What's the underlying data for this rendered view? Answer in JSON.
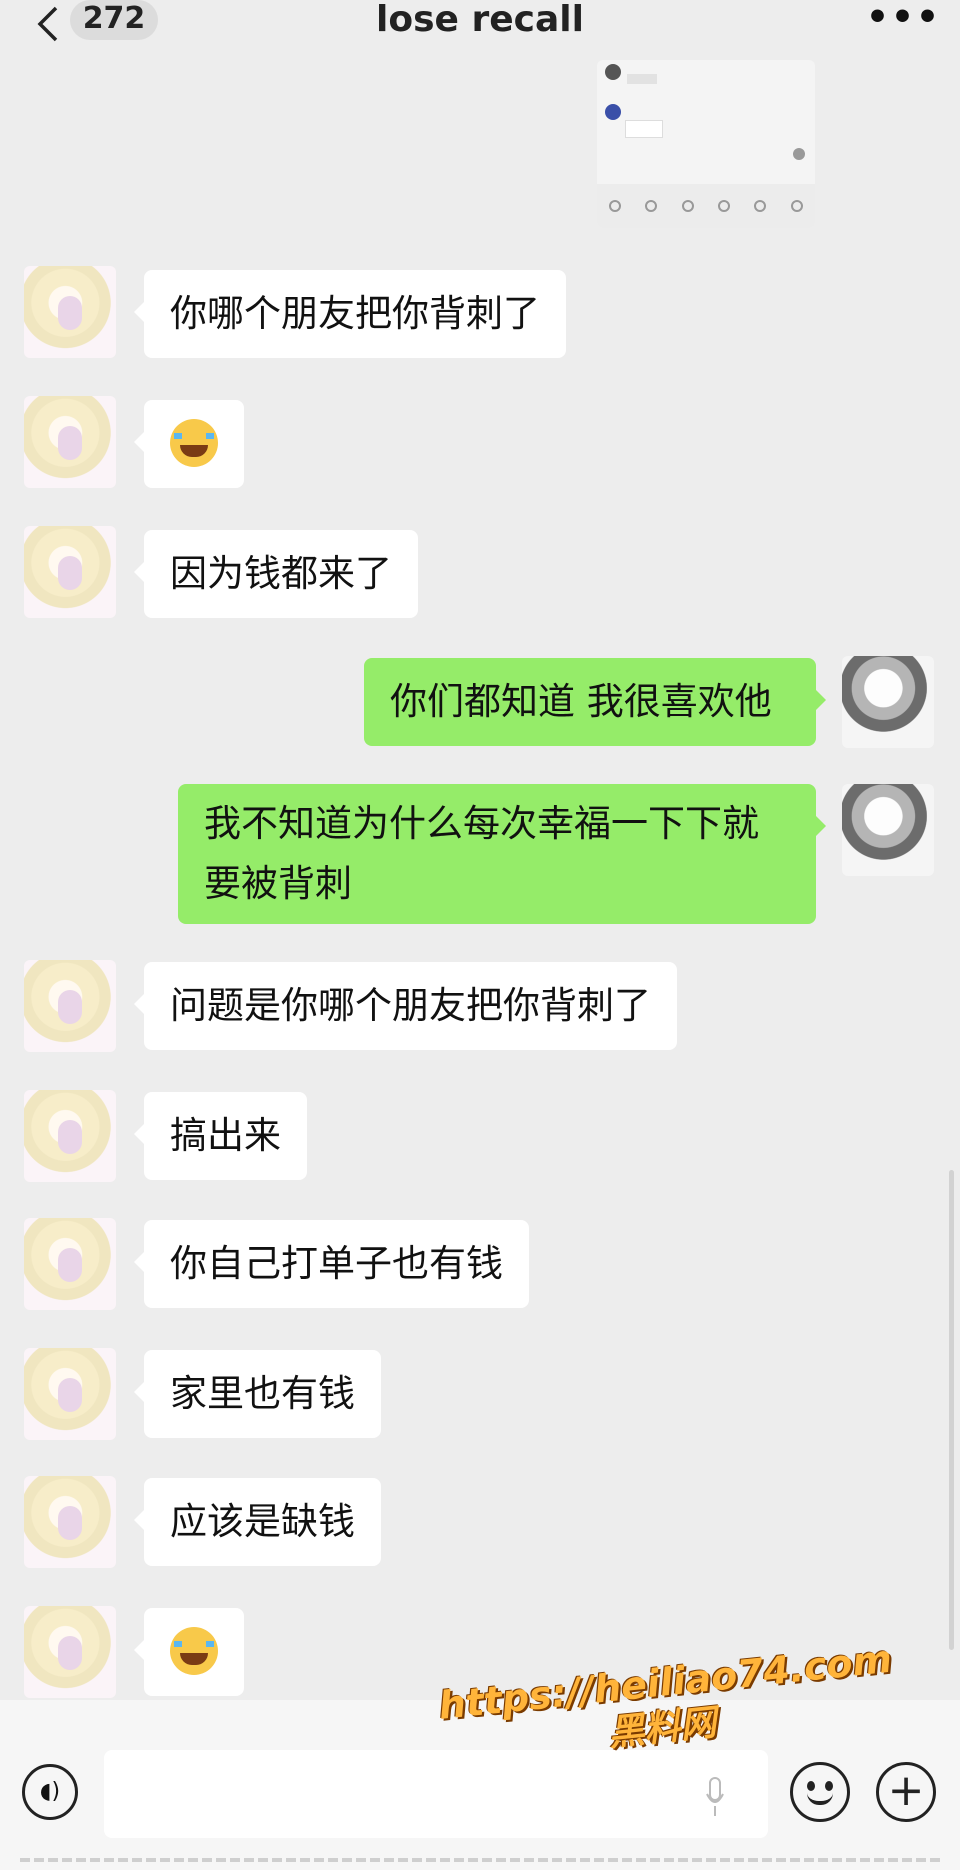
{
  "header": {
    "unread_count": "272",
    "title": "lose recall"
  },
  "messages": [
    {
      "side": "left",
      "text": "你哪个朋友把你背刺了"
    },
    {
      "side": "left",
      "emoji": "laughing-crying-emoji"
    },
    {
      "side": "left",
      "text": "因为钱都来了"
    },
    {
      "side": "right",
      "text": "你们都知道 我很喜欢他"
    },
    {
      "side": "right",
      "text_line1": "我不知道为什么每次幸福一下下就",
      "text_line2": "要被背刺"
    },
    {
      "side": "left",
      "text": "问题是你哪个朋友把你背刺了"
    },
    {
      "side": "left",
      "text": "搞出来"
    },
    {
      "side": "left",
      "text": "你自己打单子也有钱"
    },
    {
      "side": "left",
      "text": "家里也有钱"
    },
    {
      "side": "left",
      "text": "应该是缺钱"
    },
    {
      "side": "left",
      "emoji": "laughing-crying-emoji"
    }
  ],
  "watermark": {
    "url": "https://heiliao74.com",
    "name": "黑料网"
  },
  "colors": {
    "background": "#ededed",
    "sent_bubble": "#95ec69",
    "received_bubble": "#ffffff"
  }
}
